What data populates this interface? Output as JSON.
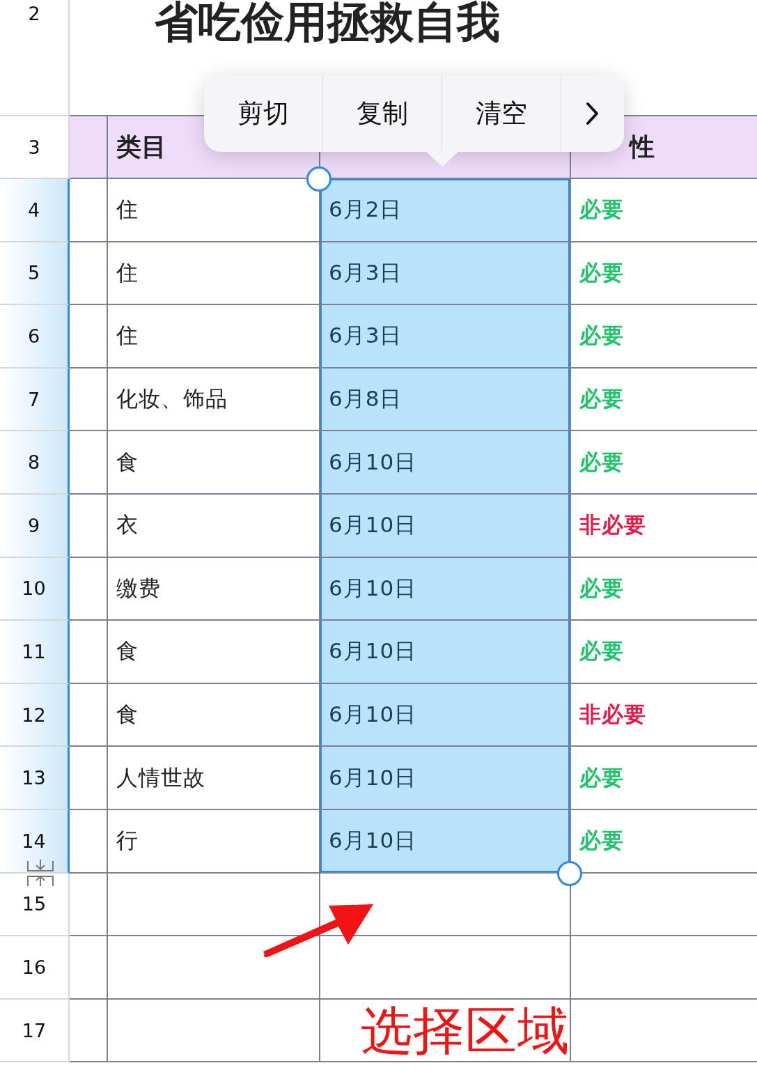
{
  "title_row": {
    "row_number": "2",
    "title": "省吃俭用拯救自我"
  },
  "header_row": {
    "row_number": "3",
    "category": "类目",
    "necessity_visible": "性"
  },
  "rows": [
    {
      "row_number": "4",
      "category": "住",
      "date": "6月2日",
      "necessity": "必要",
      "color": "#1fc36a",
      "selected": true
    },
    {
      "row_number": "5",
      "category": "住",
      "date": "6月3日",
      "necessity": "必要",
      "color": "#1fc36a",
      "selected": true
    },
    {
      "row_number": "6",
      "category": "住",
      "date": "6月3日",
      "necessity": "必要",
      "color": "#1fc36a",
      "selected": true
    },
    {
      "row_number": "7",
      "category": "化妆、饰品",
      "date": "6月8日",
      "necessity": "必要",
      "color": "#1fc36a",
      "selected": true
    },
    {
      "row_number": "8",
      "category": "食",
      "date": "6月10日",
      "necessity": "必要",
      "color": "#1fc36a",
      "selected": true
    },
    {
      "row_number": "9",
      "category": "衣",
      "date": "6月10日",
      "necessity": "非必要",
      "color": "#e8184a",
      "selected": true
    },
    {
      "row_number": "10",
      "category": "缴费",
      "date": "6月10日",
      "necessity": "必要",
      "color": "#1fc36a",
      "selected": true
    },
    {
      "row_number": "11",
      "category": "食",
      "date": "6月10日",
      "necessity": "必要",
      "color": "#1fc36a",
      "selected": true
    },
    {
      "row_number": "12",
      "category": "食",
      "date": "6月10日",
      "necessity": "非必要",
      "color": "#e8184a",
      "selected": true
    },
    {
      "row_number": "13",
      "category": "人情世故",
      "date": "6月10日",
      "necessity": "必要",
      "color": "#1fc36a",
      "selected": true
    },
    {
      "row_number": "14",
      "category": "行",
      "date": "6月10日",
      "necessity": "必要",
      "color": "#1fc36a",
      "selected": true
    },
    {
      "row_number": "15",
      "selected": false
    },
    {
      "row_number": "16",
      "selected": false
    },
    {
      "row_number": "17",
      "selected": false
    }
  ],
  "context_menu": {
    "items": [
      "剪切",
      "复制",
      "清空"
    ]
  },
  "annotation": {
    "label": "选择区域"
  }
}
